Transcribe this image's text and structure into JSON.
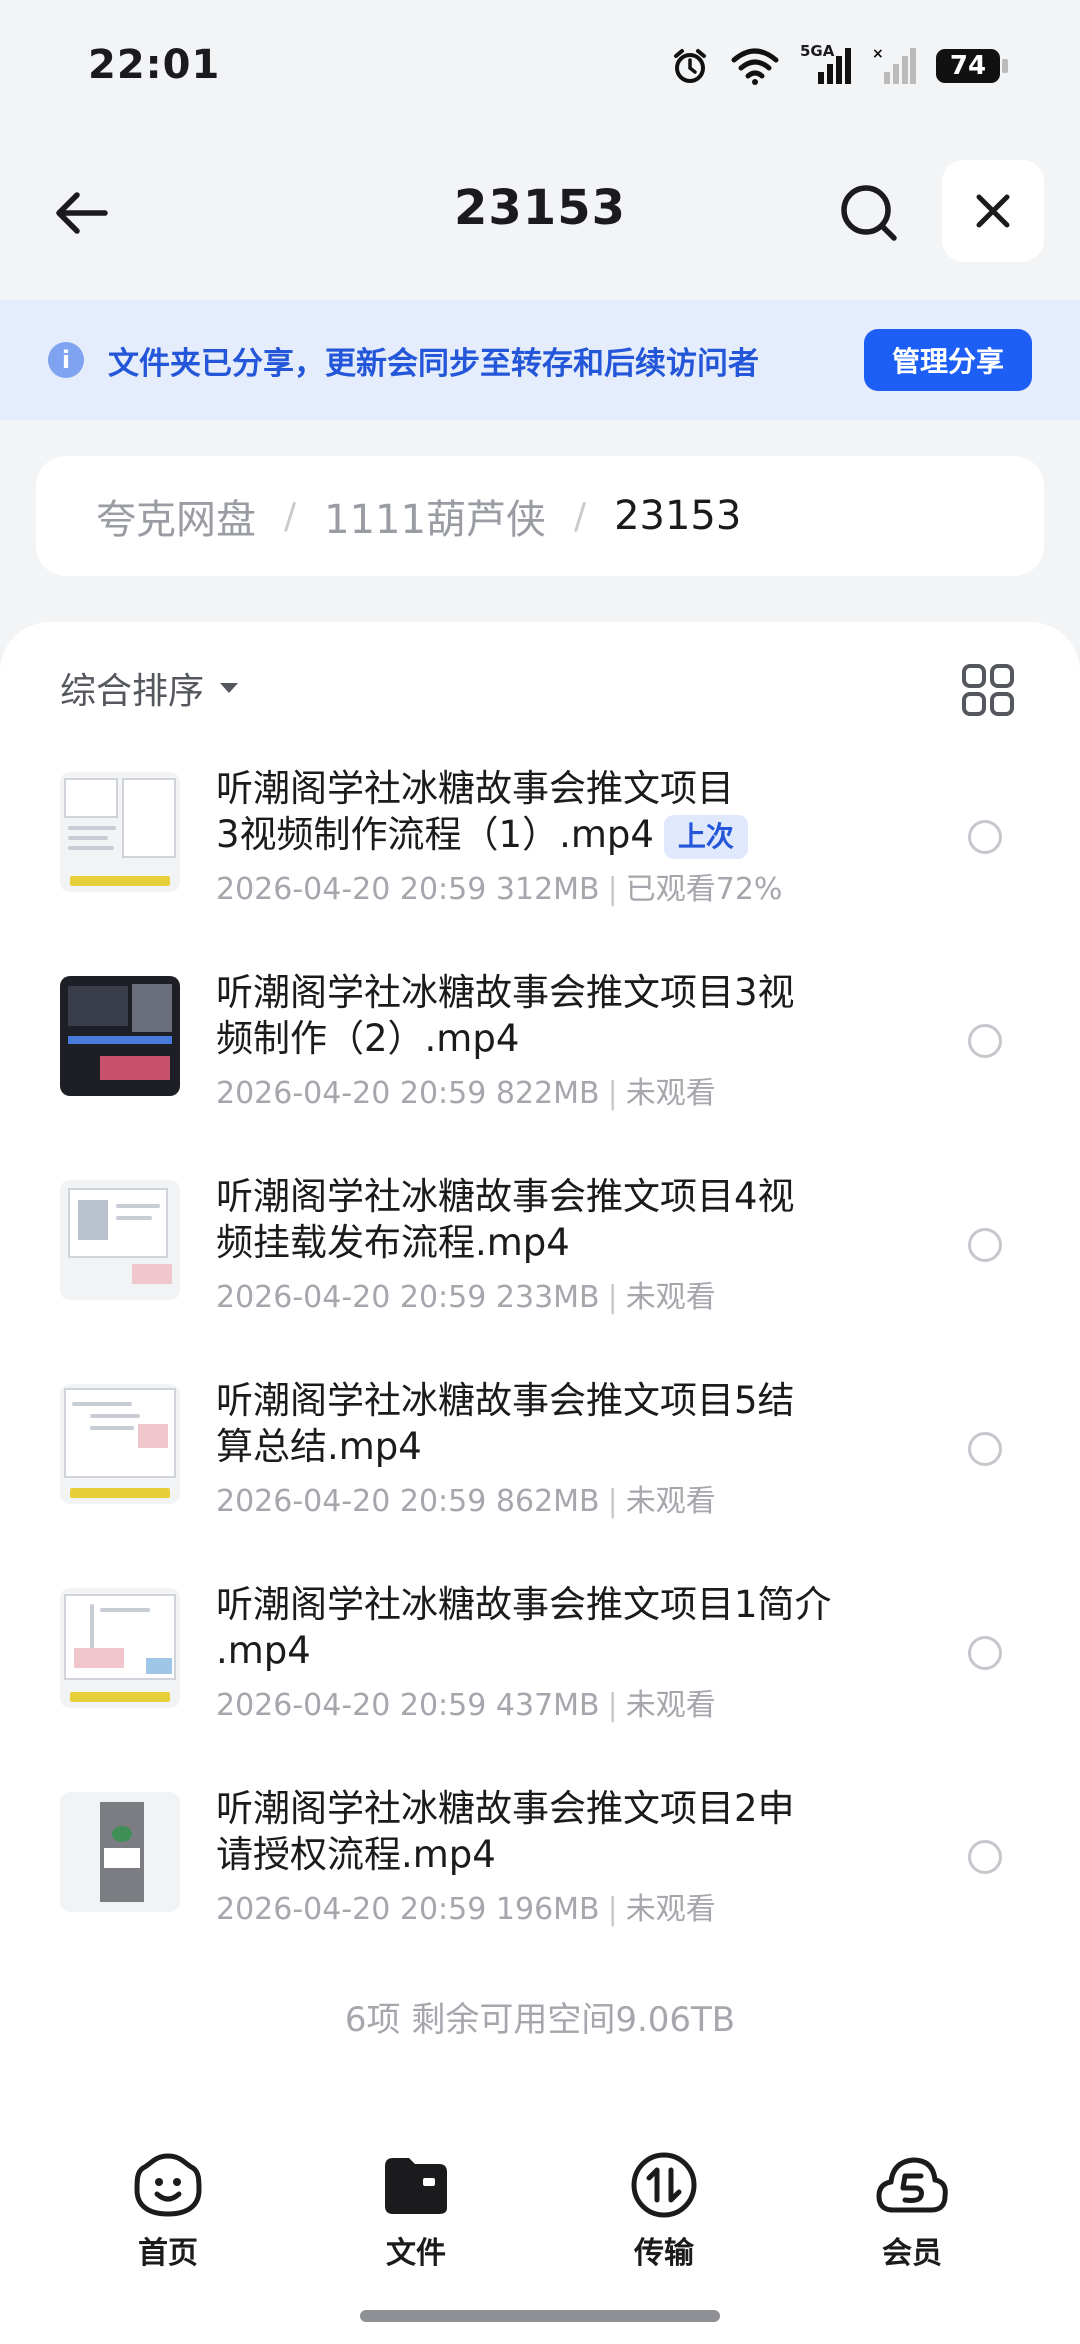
{
  "status_bar": {
    "time": "22:01",
    "battery": "74",
    "network": "5GA"
  },
  "nav": {
    "title": "23153",
    "back_icon": "arrow-left-icon",
    "search_icon": "search-icon",
    "close_icon": "close-icon"
  },
  "banner": {
    "text": "文件夹已分享，更新会同步至转存和后续访问者",
    "button": "管理分享",
    "accent": "#1d5ff5"
  },
  "breadcrumb": [
    {
      "label": "夸克网盘"
    },
    {
      "label": "1111葫芦侠"
    },
    {
      "label": "23153"
    }
  ],
  "sort": {
    "label": "综合排序"
  },
  "files": [
    {
      "name": "听潮阁学社冰糖故事会推文项目3视频制作流程（1）.mp4",
      "line1": "听潮阁学社冰糖故事会推文项目",
      "line2": "3视频制作流程（1）.mp4",
      "badge": "上次",
      "date": "2026-04-20 20:59",
      "size": "312MB",
      "status": "已观看72%",
      "thumb": "light"
    },
    {
      "name": "听潮阁学社冰糖故事会推文项目3视频制作（2）.mp4",
      "line1": "听潮阁学社冰糖故事会推文项目3视",
      "line2": "频制作（2）.mp4",
      "badge": "",
      "date": "2026-04-20 20:59",
      "size": "822MB",
      "status": "未观看",
      "thumb": "dark"
    },
    {
      "name": "听潮阁学社冰糖故事会推文项目4视频挂载发布流程.mp4",
      "line1": "听潮阁学社冰糖故事会推文项目4视",
      "line2": "频挂载发布流程.mp4",
      "badge": "",
      "date": "2026-04-20 20:59",
      "size": "233MB",
      "status": "未观看",
      "thumb": "light"
    },
    {
      "name": "听潮阁学社冰糖故事会推文项目5结算总结.mp4",
      "line1": "听潮阁学社冰糖故事会推文项目5结",
      "line2": "算总结.mp4",
      "badge": "",
      "date": "2026-04-20 20:59",
      "size": "862MB",
      "status": "未观看",
      "thumb": "light"
    },
    {
      "name": "听潮阁学社冰糖故事会推文项目1简介.mp4",
      "line1": "听潮阁学社冰糖故事会推文项目1简介",
      "line2": ".mp4",
      "badge": "",
      "date": "2026-04-20 20:59",
      "size": "437MB",
      "status": "未观看",
      "thumb": "light"
    },
    {
      "name": "听潮阁学社冰糖故事会推文项目2申请授权流程.mp4",
      "line1": "听潮阁学社冰糖故事会推文项目2申",
      "line2": "请授权流程.mp4",
      "badge": "",
      "date": "2026-04-20 20:59",
      "size": "196MB",
      "status": "未观看",
      "thumb": "light"
    }
  ],
  "summary": "6项 剩余可用空间9.06TB",
  "tabs": [
    {
      "label": "首页",
      "icon": "smile-face-icon"
    },
    {
      "label": "文件",
      "icon": "folder-icon"
    },
    {
      "label": "传输",
      "icon": "transfer-icon"
    },
    {
      "label": "会员",
      "icon": "cloud-member-icon"
    }
  ]
}
